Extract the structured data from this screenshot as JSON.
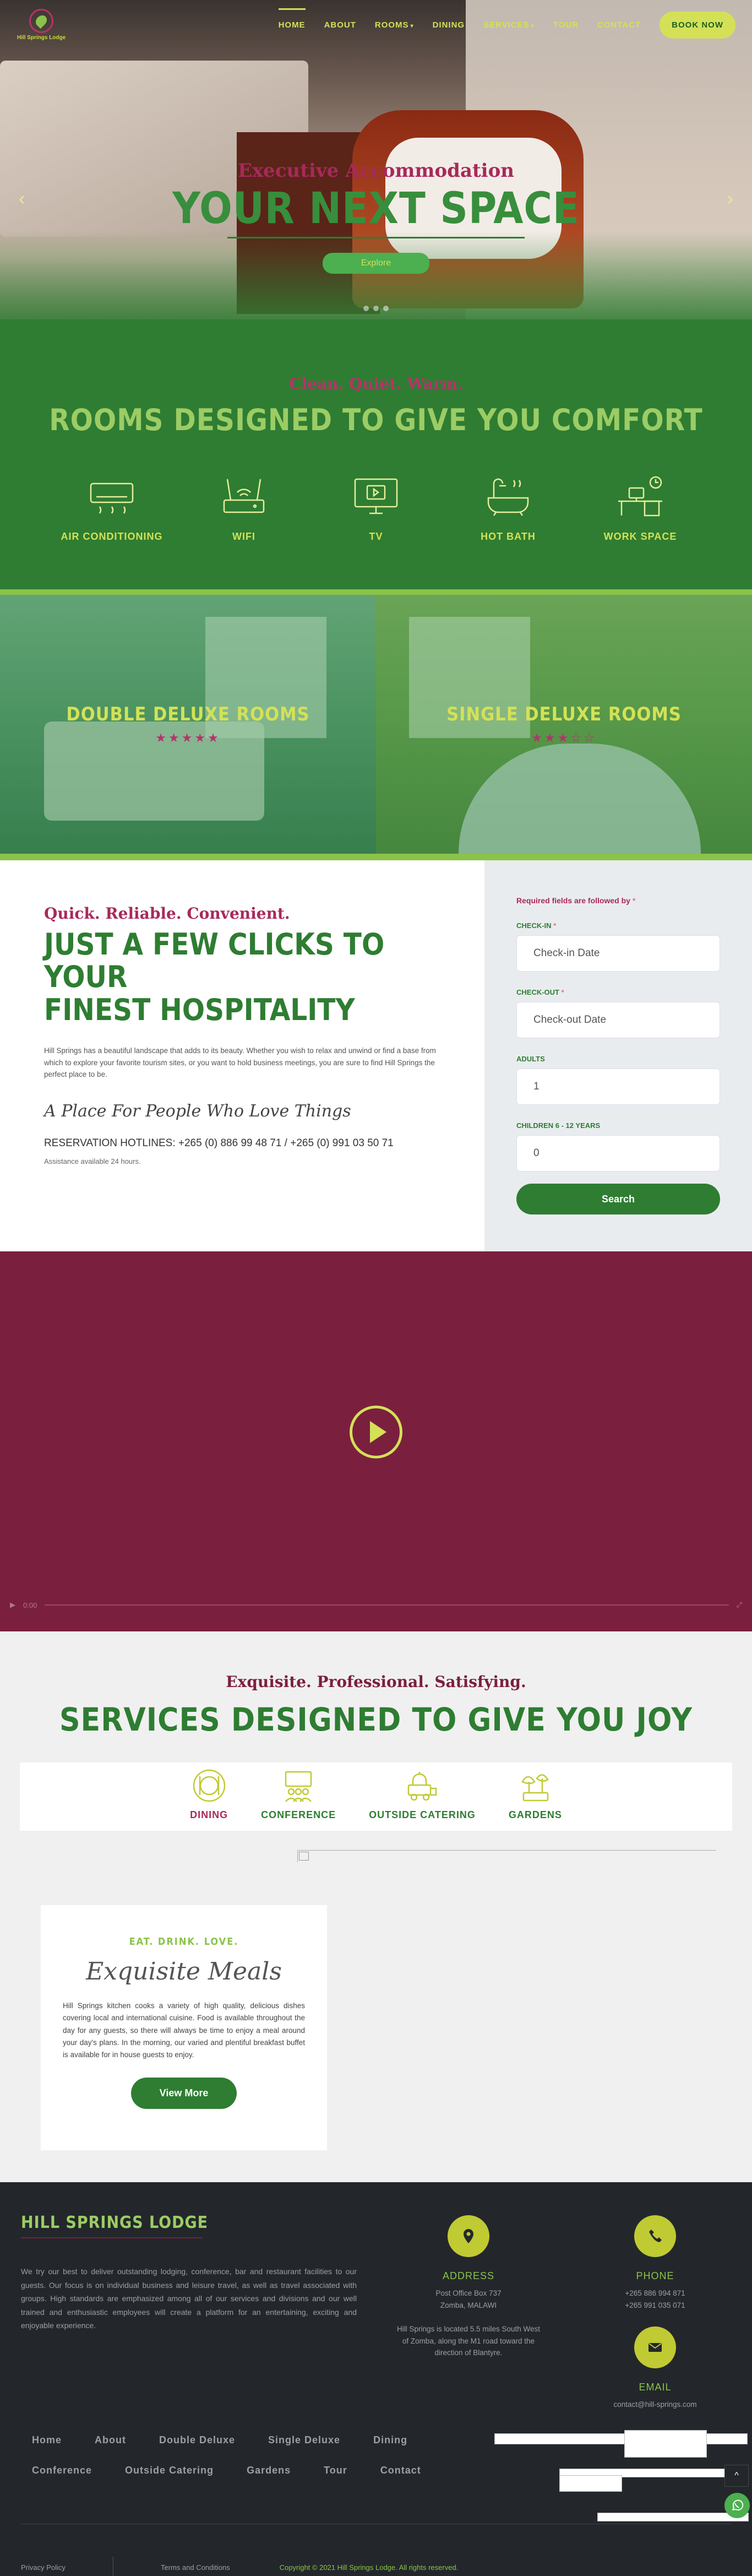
{
  "brand": {
    "logo_text": "Hill Springs Lodge"
  },
  "nav": {
    "items": [
      "HOME",
      "ABOUT",
      "ROOMS",
      "DINING",
      "SERVICES",
      "TOUR",
      "CONTACT"
    ],
    "book_now": "BOOK NOW",
    "colors": {
      "accent": "#d4e157",
      "brand_green": "#2e7d32",
      "brand_maroon": "#7b1f3f"
    }
  },
  "hero": {
    "kicker": "Executive Accommodation",
    "title": "YOUR NEXT SPACE",
    "button": "Explore",
    "prev_icon": "chevron-left-icon",
    "next_icon": "chevron-right-icon"
  },
  "amenities": {
    "kicker": "Clean. Quiet. Warm.",
    "title": "ROOMS DESIGNED TO GIVE YOU COMFORT",
    "items": [
      {
        "label": "AIR CONDITIONING",
        "icon": "air-conditioner-icon"
      },
      {
        "label": "WIFI",
        "icon": "wifi-router-icon"
      },
      {
        "label": "TV",
        "icon": "tv-icon"
      },
      {
        "label": "HOT BATH",
        "icon": "bathtub-icon"
      },
      {
        "label": "WORK SPACE",
        "icon": "desk-icon"
      }
    ]
  },
  "rooms": [
    {
      "title": "DOUBLE DELUXE ROOMS",
      "stars": "★★★★★",
      "rating": 5
    },
    {
      "title": "SINGLE DELUXE ROOMS",
      "stars": "★★★☆☆",
      "rating": 3
    }
  ],
  "booking": {
    "kicker": "Quick. Reliable. Convenient.",
    "title_line1": "JUST A FEW CLICKS TO YOUR",
    "title_line2": "FINEST HOSPITALITY",
    "description": "Hill Springs has a beautiful landscape that adds to its beauty. Whether you wish to relax and unwind or find a base from which to explore your favorite tourism sites, or you want to hold business meetings, you are sure to find Hill Springs the perfect place to be.",
    "script": "A Place For People Who Love Things",
    "hotlines": "RESERVATION HOTLINES: +265 (0) 886 99 48 71 / +265 (0) 991 03 50 71",
    "assistance": "Assistance available 24 hours.",
    "form": {
      "required_note": "Required fields are followed by",
      "asterisk": "*",
      "checkin_label": "CHECK-IN",
      "checkin_placeholder": "Check-in Date",
      "checkout_label": "CHECK-OUT",
      "checkout_placeholder": "Check-out Date",
      "adults_label": "ADULTS",
      "adults_value": "1",
      "children_label": "CHILDREN 6 - 12 YEARS",
      "children_value": "0",
      "search": "Search"
    }
  },
  "video": {
    "time": "0:00",
    "play_icon": "play-icon"
  },
  "services": {
    "kicker": "Exquisite. Professional. Satisfying.",
    "title": "SERVICES DESIGNED TO GIVE YOU JOY",
    "tabs": [
      {
        "label": "DINING",
        "icon": "dining-icon"
      },
      {
        "label": "CONFERENCE",
        "icon": "conference-icon"
      },
      {
        "label": "OUTSIDE CATERING",
        "icon": "catering-icon"
      },
      {
        "label": "GARDENS",
        "icon": "garden-icon"
      }
    ],
    "card": {
      "kicker": "EAT. DRINK. LOVE.",
      "title": "Exquisite Meals",
      "description": "Hill Springs kitchen cooks a variety of high quality, delicious dishes covering local and international cuisine. Food is available throughout the day for any guests, so there will always be time to enjoy a meal around your day's plans. In the morning, our varied and plentiful breakfast buffet is available for in house guests to enjoy.",
      "button": "View More"
    }
  },
  "footer": {
    "title": "HILL SPRINGS LODGE",
    "description": "We try our best to deliver outstanding lodging, conference, bar and restaurant facilities to our guests. Our focus is on individual business and leisure travel, as well as travel associated with groups. High standards are emphasized among all of our services and divisions and our well trained and enthusiastic employees will create a platform for an entertaining, exciting and enjoyable experience.",
    "address_head": "ADDRESS",
    "address_line1": "Post Office Box 737",
    "address_line2": "Zomba, MALAWI",
    "address_note": "Hill Springs is located 5.5 miles South West of Zomba, along the M1 road toward the direction of Blantyre.",
    "phone_head": "PHONE",
    "phone1": "+265 886 994 871",
    "phone2": "+265 991 035 071",
    "email_head": "EMAIL",
    "email": "contact@hill-springs.com",
    "links_row1": [
      "Home",
      "About",
      "Double Deluxe",
      "Single Deluxe",
      "Dining"
    ],
    "links_row2": [
      "Conference",
      "Outside Catering",
      "Gardens",
      "Tour",
      "Contact"
    ],
    "privacy": "Privacy Policy",
    "terms": "Terms and Conditions",
    "copyright": "Copyright © 2021 Hill Springs Lodge. All rights reserved."
  }
}
